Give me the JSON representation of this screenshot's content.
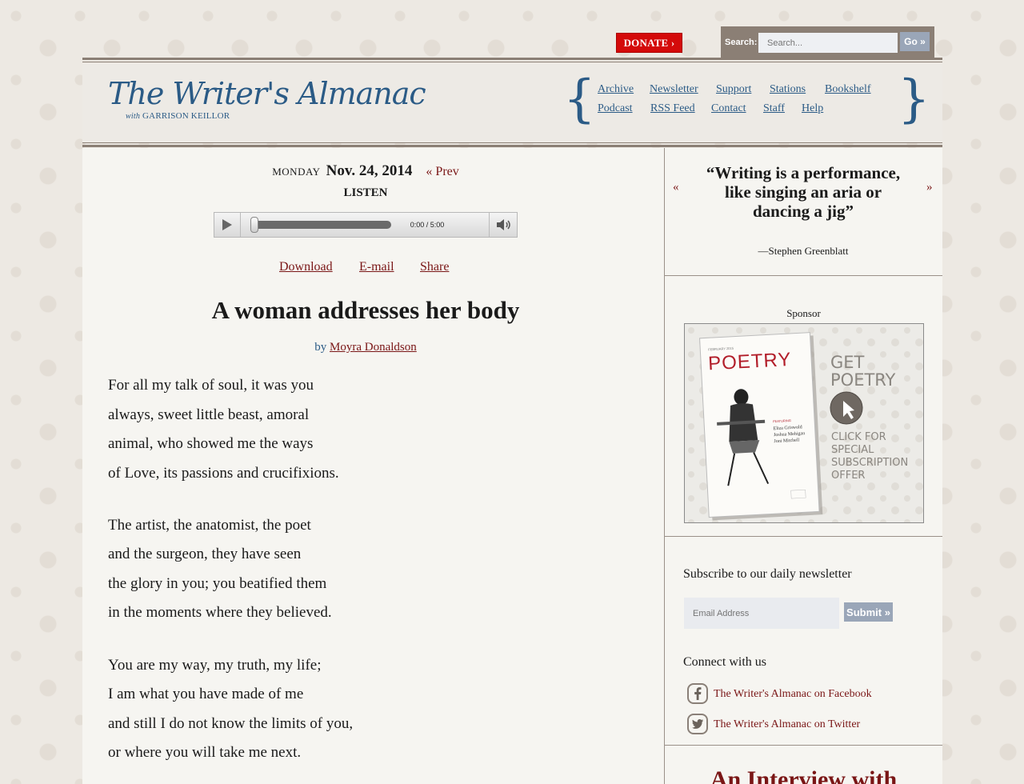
{
  "topbar": {
    "donate_label": "DONATE ›",
    "search_label": "Search:",
    "search_placeholder": "Search...",
    "go_label": "Go »"
  },
  "header": {
    "logo_text": "The Writer's Almanac",
    "logo_subtitle_with": "with",
    "logo_subtitle_name": "GARRISON KEILLOR",
    "nav_row1": [
      "Archive",
      "Newsletter",
      "Support",
      "Stations",
      "Bookshelf"
    ],
    "nav_row2": [
      "Podcast",
      "RSS Feed",
      "Contact",
      "Staff",
      "Help"
    ]
  },
  "episode": {
    "day_of_week": "MONDAY",
    "date": "Nov. 24, 2014",
    "prev_label": "« Prev",
    "listen_label": "LISTEN",
    "player_time": "0:00 / 5:00",
    "actions": [
      "Download",
      "E-mail",
      "Share"
    ]
  },
  "poem": {
    "title": "A woman addresses her body",
    "by_label": "by",
    "author": "Moyra Donaldson",
    "stanzas": [
      [
        "For all my talk of soul, it was you",
        "always, sweet little beast, amoral",
        "animal, who showed me the ways",
        "of Love, its passions and crucifixions."
      ],
      [
        "The artist, the anatomist, the poet",
        "and the surgeon, they have seen",
        "the glory in you; you beatified them",
        "in the moments where they believed."
      ],
      [
        "You are my way, my truth, my life;",
        "I am what you have made of me",
        "and still I do not know the limits of you,",
        "or where you will take me next."
      ]
    ]
  },
  "sidebar": {
    "quote_prev": "«",
    "quote_next": "»",
    "quote_text": "“Writing is a performance, like singing an aria or dancing a jig”",
    "quote_author": "—Stephen Greenblatt",
    "sponsor_label": "Sponsor",
    "ad": {
      "magazine_month": "FEBRUARY 2015",
      "magazine_title": "POETRY",
      "featuring": "FEATURING",
      "names": [
        "Eliza Griswold",
        "Joshua Mehigan",
        "Joni Mitchell"
      ],
      "headline1": "GET",
      "headline2": "POETRY",
      "cta": [
        "CLICK FOR",
        "SPECIAL",
        "SUBSCRIPTION",
        "OFFER"
      ]
    },
    "newsletter_title": "Subscribe to our daily newsletter",
    "email_placeholder": "Email Address",
    "submit_label": "Submit »",
    "connect_title": "Connect with us",
    "facebook_label": "The Writer's Almanac on Facebook",
    "twitter_label": "The Writer's Almanac on Twitter",
    "interview_heading": "An Interview with"
  },
  "colors": {
    "link_red": "#7a1616",
    "brand_blue": "#2b5b86",
    "donate_red": "#d40a0a",
    "rule_brown": "#8b7f75"
  }
}
